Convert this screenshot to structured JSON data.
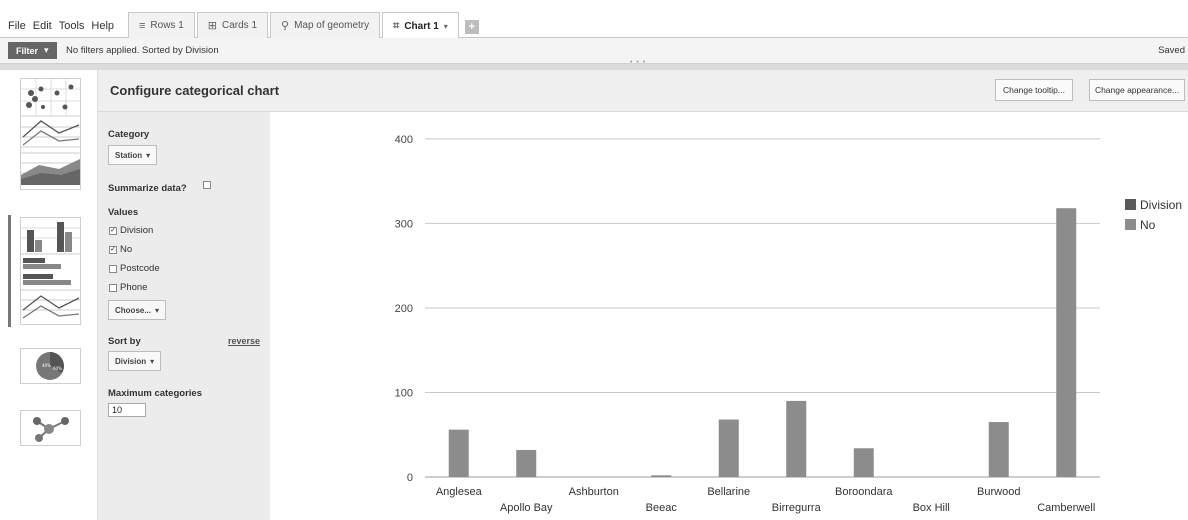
{
  "menu": [
    "File",
    "Edit",
    "Tools",
    "Help"
  ],
  "tabs": [
    {
      "label": "Rows 1",
      "icon": "rows-icon",
      "glyph": "≡",
      "active": false
    },
    {
      "label": "Cards 1",
      "icon": "cards-icon",
      "glyph": "⊞",
      "active": false
    },
    {
      "label": "Map of geometry",
      "icon": "map-pin-icon",
      "glyph": "⚲",
      "active": false
    },
    {
      "label": "Chart 1",
      "icon": "chart-icon",
      "glyph": "⌗",
      "active": true
    }
  ],
  "tab_add": "+",
  "filter": {
    "button": "Filter",
    "text": "No filters applied. Sorted by Division",
    "saved": "Saved"
  },
  "config": {
    "title": "Configure categorical chart",
    "change_tooltip": "Change tooltip...",
    "change_appearance": "Change appearance...",
    "category_label": "Category",
    "category_value": "Station",
    "summarize_label": "Summarize data?",
    "summarize_checked": false,
    "values_label": "Values",
    "values": [
      {
        "label": "Division",
        "checked": true
      },
      {
        "label": "No",
        "checked": true
      },
      {
        "label": "Postcode",
        "checked": false
      },
      {
        "label": "Phone",
        "checked": false
      }
    ],
    "choose_label": "Choose...",
    "sort_label": "Sort by",
    "reverse_label": "reverse",
    "sort_value": "Division",
    "maxcat_label": "Maximum categories",
    "maxcat_value": "10"
  },
  "colors": {
    "division": "#595959",
    "no": "#8c8c8c",
    "header_bg": "#efefef",
    "panel_bg": "#ececec"
  },
  "chart_data": {
    "type": "bar",
    "categories": [
      "Anglesea",
      "Apollo Bay",
      "Ashburton",
      "Beeac",
      "Bellarine",
      "Birregurra",
      "Boroondara",
      "Box Hill",
      "Burwood",
      "Camberwell"
    ],
    "series": [
      {
        "name": "Division",
        "values": [
          0,
          0,
          0,
          0,
          0,
          0,
          0,
          0,
          0,
          0
        ]
      },
      {
        "name": "No",
        "values": [
          56,
          32,
          0,
          2,
          68,
          90,
          34,
          0,
          65,
          318
        ]
      }
    ],
    "yticks": [
      0,
      100,
      200,
      300,
      400
    ],
    "ylim": [
      0,
      420
    ],
    "grid": true,
    "legend": "right"
  }
}
